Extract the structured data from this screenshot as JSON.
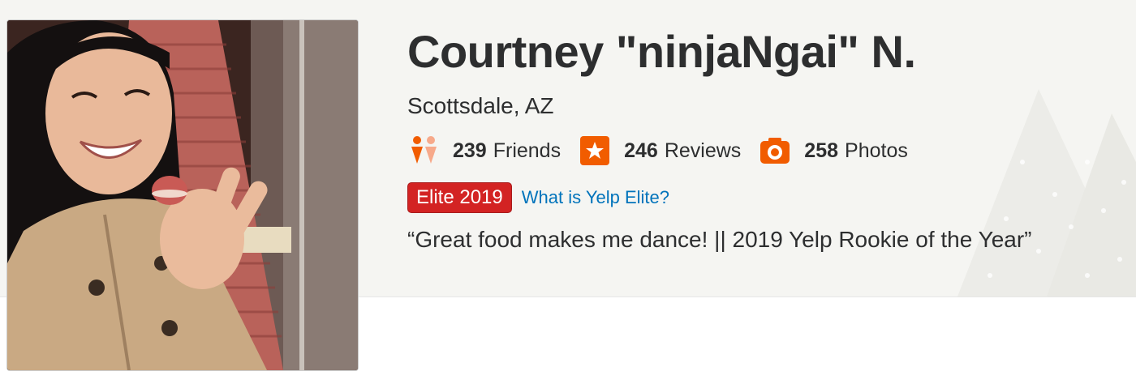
{
  "profile": {
    "name": "Courtney \"ninjaNgai\" N.",
    "location": "Scottsdale, AZ",
    "tagline": "“Great food makes me dance! || 2019 Yelp Rookie of the Year”",
    "photo_icon": "profile-photo"
  },
  "stats": {
    "friends": {
      "count": "239",
      "label": "Friends",
      "icon": "friends-icon"
    },
    "reviews": {
      "count": "246",
      "label": "Reviews",
      "icon": "star-icon"
    },
    "photos": {
      "count": "258",
      "label": "Photos",
      "icon": "camera-icon"
    }
  },
  "elite": {
    "badge": "Elite 2019",
    "link": "What is Yelp Elite?"
  },
  "colors": {
    "brand_red": "#d32323",
    "icon_orange": "#f15c00",
    "link_blue": "#0073bb",
    "band_bg": "#f5f5f2",
    "text": "#2d2e2f"
  }
}
